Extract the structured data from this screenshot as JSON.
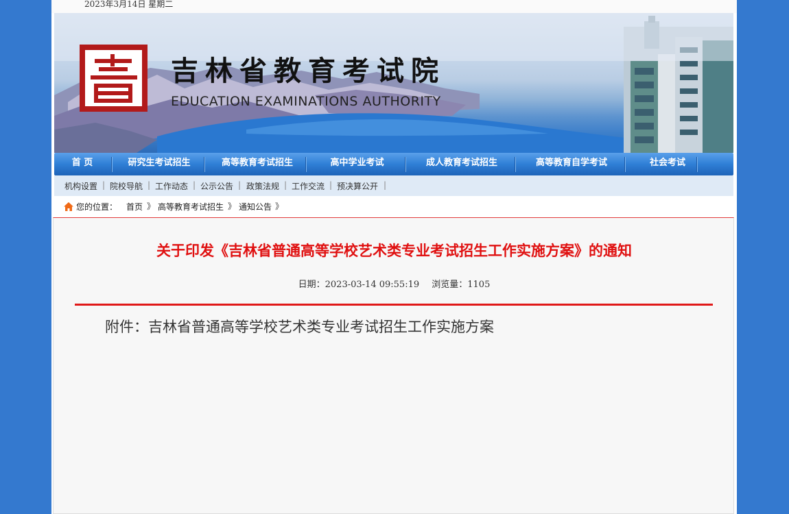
{
  "date_bar": {
    "text": "2023年3月14日 星期二"
  },
  "banner": {
    "title": "吉林省教育考试院",
    "subtitle": "EDUCATION EXAMINATIONS AUTHORITY",
    "logo_icon": "exam-authority-logo-icon"
  },
  "nav": {
    "items": [
      {
        "label": "首 页"
      },
      {
        "label": "研究生考试招生"
      },
      {
        "label": "高等教育考试招生"
      },
      {
        "label": "高中学业考试"
      },
      {
        "label": "成人教育考试招生"
      },
      {
        "label": "高等教育自学考试"
      },
      {
        "label": "社会考试"
      }
    ]
  },
  "subnav": {
    "items": [
      {
        "label": "机构设置"
      },
      {
        "label": "院校导航"
      },
      {
        "label": "工作动态"
      },
      {
        "label": "公示公告"
      },
      {
        "label": "政策法规"
      },
      {
        "label": "工作交流"
      },
      {
        "label": "预决算公开"
      }
    ],
    "separator": "|"
  },
  "breadcrumb": {
    "prefix": "您的位置：",
    "items": [
      {
        "label": "首页"
      },
      {
        "label": "高等教育考试招生"
      },
      {
        "label": "通知公告"
      }
    ],
    "separator": "》"
  },
  "article": {
    "title": "关于印发《吉林省普通高等学校艺术类专业考试招生工作实施方案》的通知",
    "date_label": "日期：2023-03-14 09:55:19",
    "views_label": "浏览量：1105",
    "attachment_text": "附件：吉林省普通高等学校艺术类专业考试招生工作实施方案"
  },
  "colors": {
    "background": "#3479cf",
    "nav": "#2f7fd6",
    "title_red": "#e01010",
    "logo_red": "#b21a1a"
  }
}
